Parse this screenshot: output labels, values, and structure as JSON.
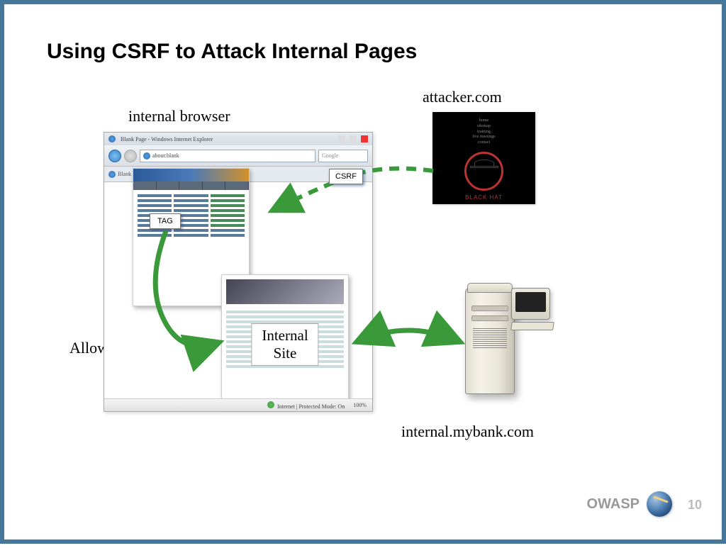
{
  "slide": {
    "title": "Using CSRF to Attack Internal Pages",
    "page_number": "10",
    "footer_org": "OWASP"
  },
  "labels": {
    "internal_browser": "internal browser",
    "attacker": "attacker.com",
    "allowed": "Allowed!",
    "internal_server": "internal.mybank.com",
    "csrf_box": "CSRF",
    "tag_box": "TAG",
    "internal_site": "Internal\nSite"
  },
  "browser": {
    "title": "Blank Page - Windows Internet Explorer",
    "address": "about:blank",
    "search_placeholder": "Google",
    "tab": "Blank Page",
    "status_mode": "Internet | Protected Mode: On",
    "zoom": "100%"
  },
  "attacker_box": {
    "brand": "BLACK HAT"
  },
  "arrows": {
    "csrf_dashed": {
      "from": "attacker.com",
      "to": "internal browser page",
      "style": "dashed",
      "color": "#3a9a3a"
    },
    "tag_to_internal": {
      "from": "TAG",
      "to": "Internal Site",
      "style": "solid",
      "color": "#3a9a3a",
      "label": "Allowed!"
    },
    "internal_to_server": {
      "from": "Internal Site",
      "to": "internal.mybank.com",
      "style": "solid-double-arrow",
      "color": "#3a9a3a"
    }
  }
}
